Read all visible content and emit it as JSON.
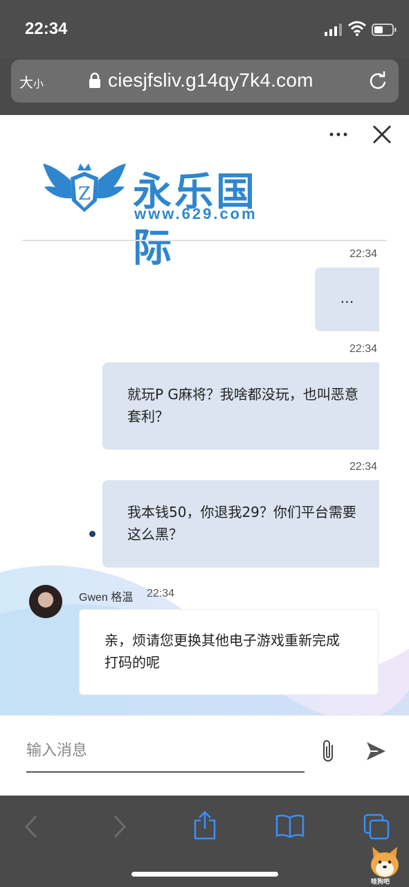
{
  "status_bar": {
    "time": "22:34"
  },
  "url_bar": {
    "text_size_big": "大",
    "text_size_small": "小",
    "url": "ciesjfsliv.g14qy7k4.com"
  },
  "brand": {
    "name": "永乐国际",
    "url": "www.629.com"
  },
  "messages": [
    {
      "time": "22:34",
      "text": "…"
    },
    {
      "time": "22:34",
      "text": "就玩P G麻将？我啥都没玩，也叫恶意套利？"
    },
    {
      "time": "22:34",
      "text": "我本钱50，你退我29？你们平台需要这么黑？"
    }
  ],
  "agent_message": {
    "name": "Gwen 格温",
    "time": "22:34",
    "text": "亲，烦请您更换其他电子游戏重新完成打码的呢"
  },
  "input": {
    "placeholder": "输入消息"
  },
  "watermark": {
    "label": "哇狗吧"
  },
  "colors": {
    "accent": "#2f86cf",
    "bubble_out": "#dbe4f0",
    "toolbar": "#4a4a4a"
  }
}
